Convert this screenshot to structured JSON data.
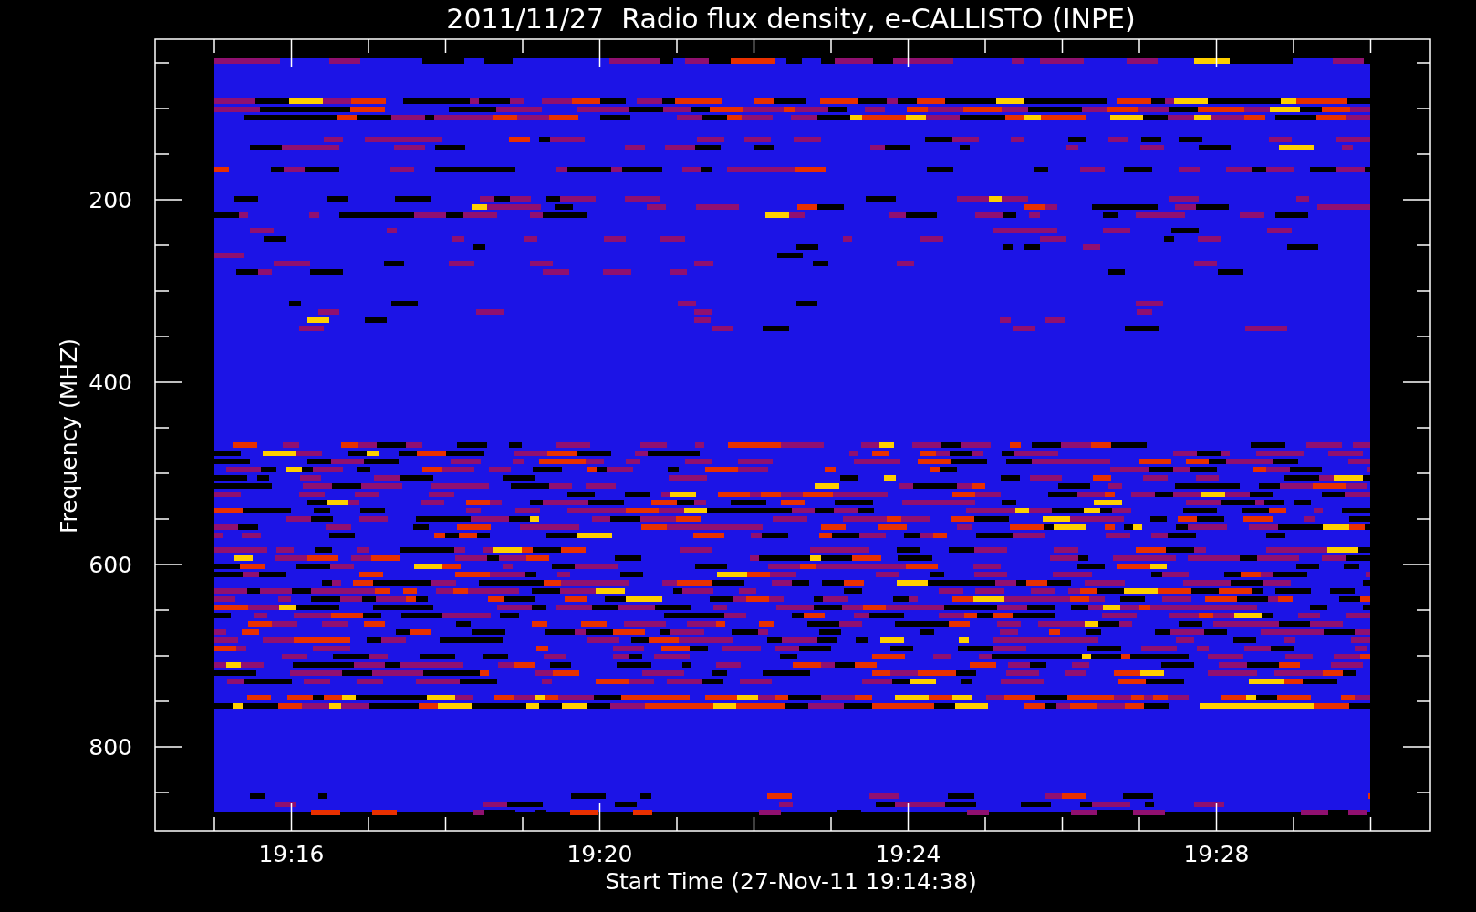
{
  "title": "2011/11/27  Radio flux density, e-CALLISTO (INPE)",
  "y_axis": {
    "label": "Frequency (MHZ)",
    "ticks": [
      "200",
      "400",
      "600",
      "800"
    ]
  },
  "x_axis": {
    "label": "Start Time (27-Nov-11 19:14:38)",
    "ticks": [
      "19:16",
      "19:20",
      "19:24",
      "19:28"
    ]
  }
}
